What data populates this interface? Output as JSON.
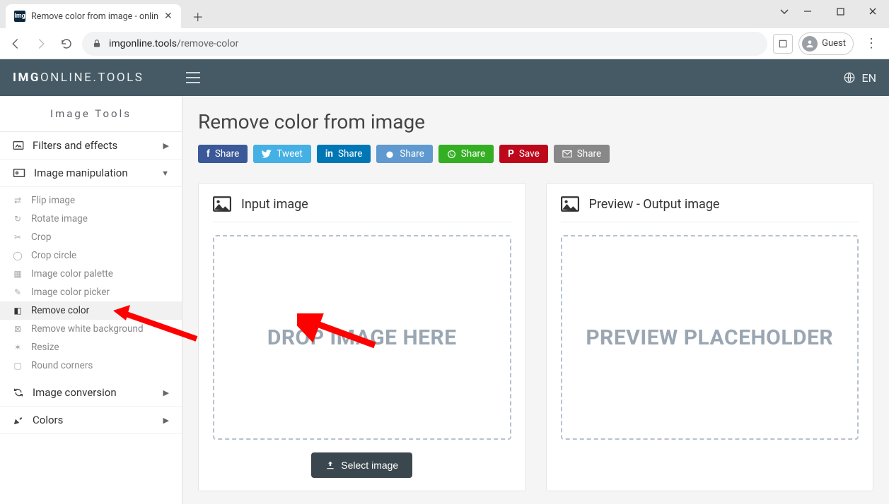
{
  "browser": {
    "tab_title": "Remove color from image - onlin",
    "url_host": "imgonline.tools",
    "url_path": "/remove-color",
    "guest_label": "Guest"
  },
  "header": {
    "brand_strong": "IMG",
    "brand_rest": "ONLINE.TOOLS",
    "lang": "EN"
  },
  "sidebar": {
    "title": "Image Tools",
    "cat_filters": "Filters and effects",
    "cat_manip": "Image manipulation",
    "cat_conv": "Image conversion",
    "cat_colors": "Colors",
    "items": {
      "flip": "Flip image",
      "rotate": "Rotate image",
      "crop": "Crop",
      "cropcircle": "Crop circle",
      "palette": "Image color palette",
      "picker": "Image color picker",
      "removecolor": "Remove color",
      "removewhite": "Remove white background",
      "resize": "Resize",
      "round": "Round corners"
    }
  },
  "main": {
    "title": "Remove color from image",
    "share": {
      "share": "Share",
      "tweet": "Tweet",
      "save": "Save"
    },
    "input_panel_title": "Input image",
    "preview_panel_title": "Preview - Output image",
    "dropzone_text": "DROP IMAGE HERE",
    "preview_text": "PREVIEW PLACEHOLDER",
    "select_button": "Select image"
  }
}
